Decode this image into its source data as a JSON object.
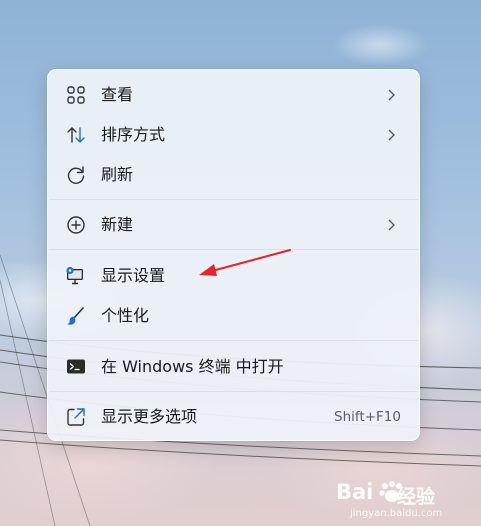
{
  "menu": {
    "items": [
      {
        "label": "查看",
        "icon": "grid-icon",
        "submenu": true
      },
      {
        "label": "排序方式",
        "icon": "sort-icon",
        "submenu": true
      },
      {
        "label": "刷新",
        "icon": "refresh-icon"
      },
      {
        "label": "新建",
        "icon": "plus-circle-icon",
        "submenu": true
      },
      {
        "label": "显示设置",
        "icon": "display-settings-icon"
      },
      {
        "label": "个性化",
        "icon": "brush-icon"
      },
      {
        "label": "在 Windows 终端 中打开",
        "icon": "terminal-icon"
      },
      {
        "label": "显示更多选项",
        "icon": "share-icon",
        "shortcut": "Shift+F10"
      }
    ]
  },
  "colors": {
    "menu_bg": "#eef2f8",
    "icon_blue": "#1f6fd1",
    "arrow_red": "#e8242a"
  },
  "watermark": {
    "brand_text": "Bai",
    "brand_cn": "经验",
    "url": "jingyan.baidu.com"
  }
}
